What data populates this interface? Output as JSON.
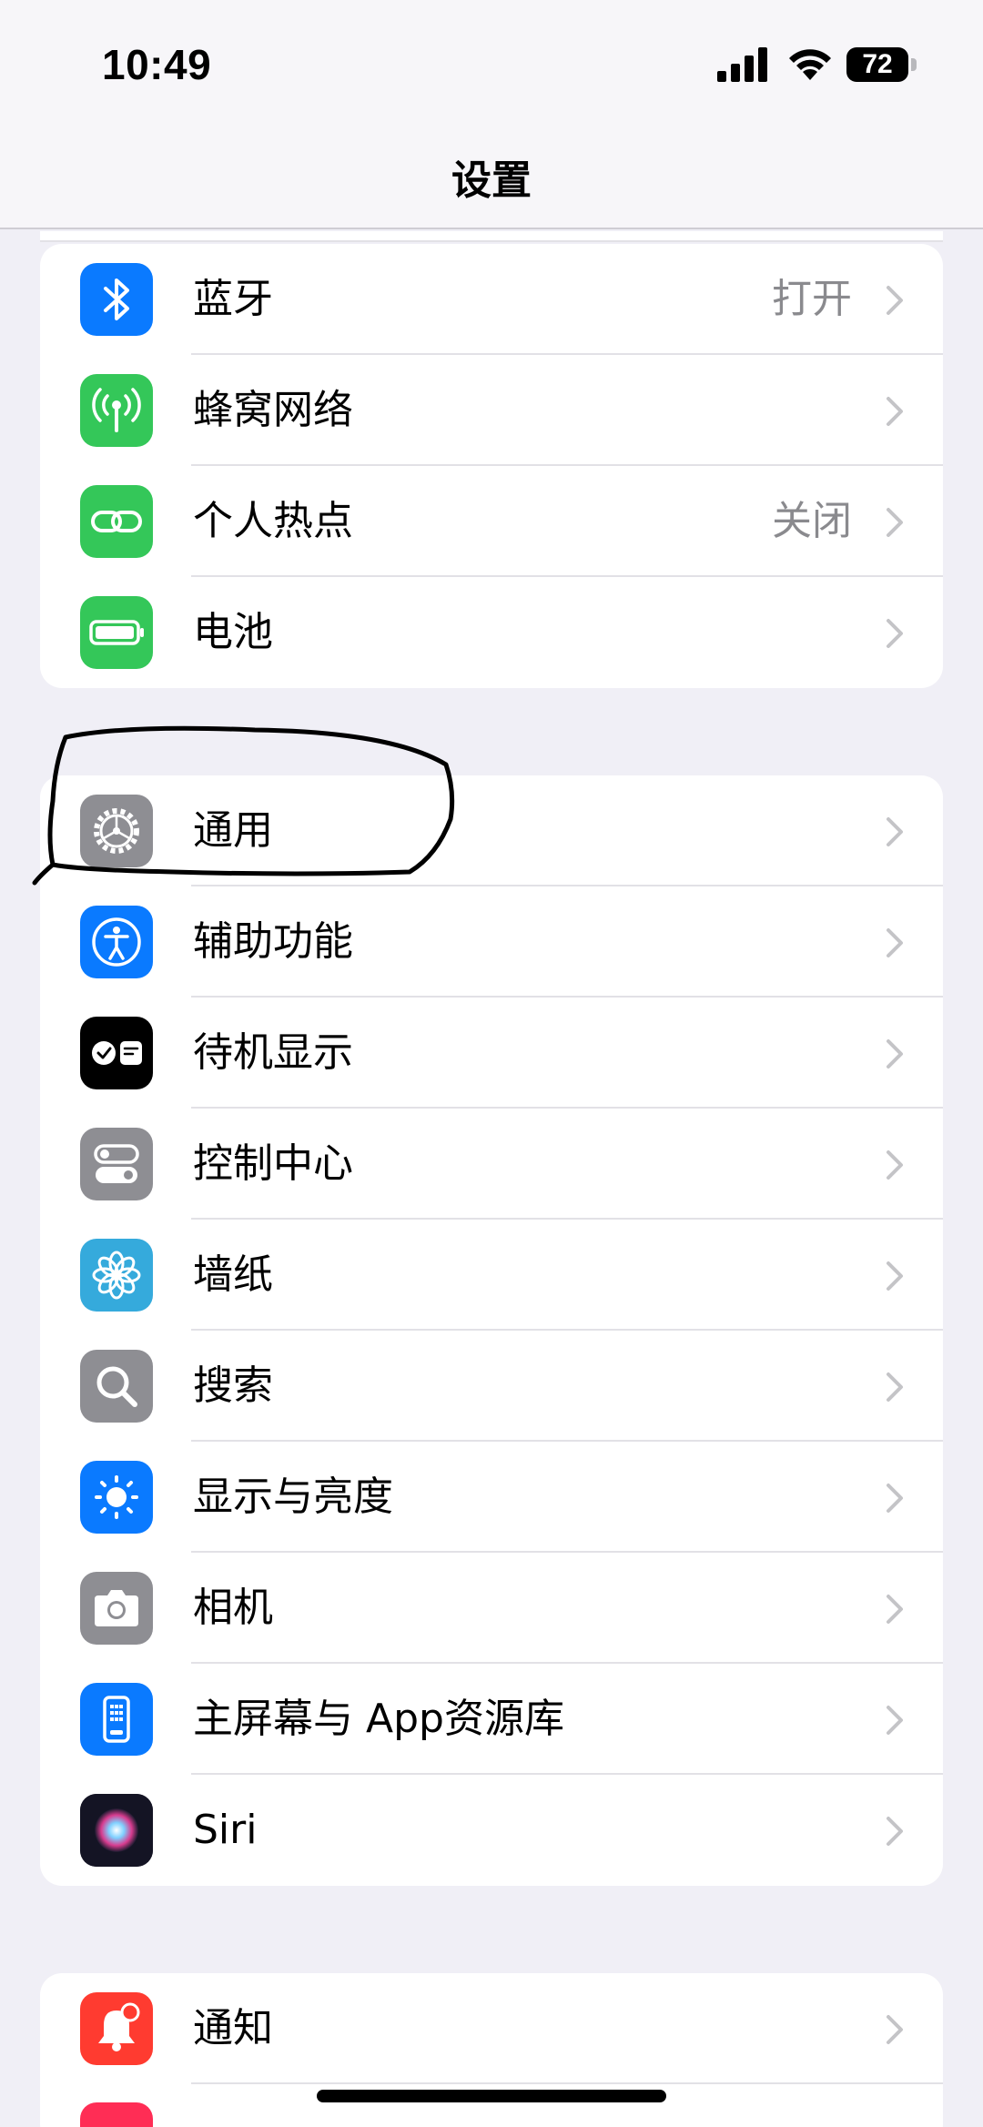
{
  "status_bar": {
    "time": "10:49",
    "battery_level": "72"
  },
  "nav": {
    "title": "设置"
  },
  "groups": {
    "connectivity": [
      {
        "label": "蓝牙",
        "value": "打开",
        "icon": "bluetooth-icon",
        "color": "#0a7aff"
      },
      {
        "label": "蜂窝网络",
        "value": "",
        "icon": "cellular-icon",
        "color": "#34c759"
      },
      {
        "label": "个人热点",
        "value": "关闭",
        "icon": "hotspot-icon",
        "color": "#34c759"
      },
      {
        "label": "电池",
        "value": "",
        "icon": "battery-icon",
        "color": "#34c759"
      }
    ],
    "general": [
      {
        "label": "通用",
        "icon": "gear-icon",
        "color": "#8e8e93"
      },
      {
        "label": "辅助功能",
        "icon": "accessibility-icon",
        "color": "#0a7aff"
      },
      {
        "label": "待机显示",
        "icon": "standby-icon",
        "color": "#000000"
      },
      {
        "label": "控制中心",
        "icon": "control-center-icon",
        "color": "#8e8e93"
      },
      {
        "label": "墙纸",
        "icon": "wallpaper-icon",
        "color": "#35aadc"
      },
      {
        "label": "搜索",
        "icon": "search-icon",
        "color": "#8e8e93"
      },
      {
        "label": "显示与亮度",
        "icon": "brightness-icon",
        "color": "#0a7aff"
      },
      {
        "label": "相机",
        "icon": "camera-icon",
        "color": "#8e8e93"
      },
      {
        "label": "主屏幕与 App资源库",
        "icon": "home-screen-icon",
        "color": "#0a7aff"
      },
      {
        "label": "Siri",
        "icon": "siri-icon",
        "color": "#1a1a2e"
      }
    ],
    "notifications": [
      {
        "label": "通知",
        "icon": "notification-bell-icon",
        "color": "#ff3b30"
      }
    ]
  }
}
